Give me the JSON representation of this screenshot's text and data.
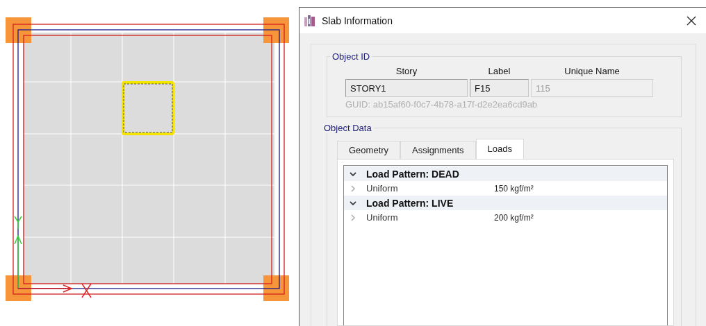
{
  "window": {
    "title": "Slab Information"
  },
  "object_id": {
    "title": "Object ID",
    "fields": [
      {
        "header": "Story",
        "value": "STORY1",
        "disabled": false
      },
      {
        "header": "Label",
        "value": "F15",
        "disabled": false
      },
      {
        "header": "Unique Name",
        "value": "115",
        "disabled": true
      }
    ],
    "guid": "GUID:  ab15af60-f0c7-4b78-a17f-d2e2ea6cd9ab"
  },
  "object_data": {
    "title": "Object Data",
    "tabs": [
      {
        "label": "Geometry",
        "selected": false
      },
      {
        "label": "Assignments",
        "selected": false
      },
      {
        "label": "Loads",
        "selected": true
      }
    ],
    "tree": [
      {
        "label": "Load Pattern: DEAD",
        "expanded": true,
        "children": [
          {
            "name": "Uniform",
            "value": "150 kgf/m²",
            "expanded": false
          }
        ]
      },
      {
        "label": "Load Pattern: LIVE",
        "expanded": true,
        "children": [
          {
            "name": "Uniform",
            "value": "200 kgf/m²",
            "expanded": false
          }
        ]
      }
    ]
  }
}
